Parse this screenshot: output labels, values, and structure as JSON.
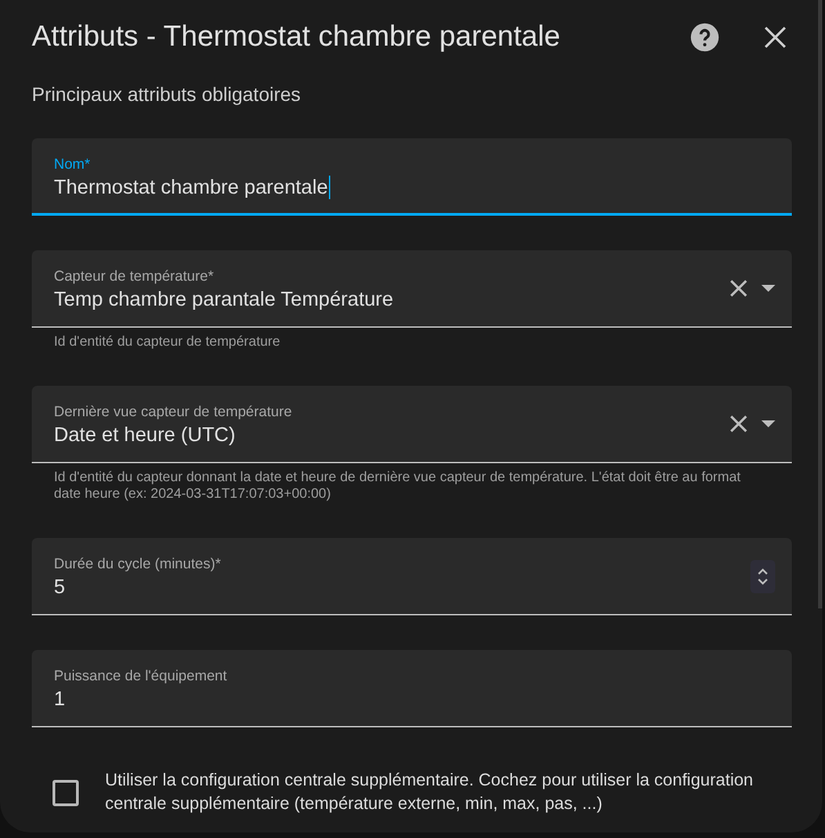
{
  "dialog": {
    "title": "Attributs - Thermostat chambre parentale",
    "subtitle": "Principaux attributs obligatoires"
  },
  "fields": [
    {
      "kind": "text",
      "label": "Nom*",
      "value": "Thermostat chambre parentale",
      "focused": true
    },
    {
      "kind": "select",
      "label": "Capteur de température*",
      "value": "Temp chambre parantale Température",
      "focused": false,
      "helper": "Id d'entité du capteur de température"
    },
    {
      "kind": "select",
      "label": "Dernière vue capteur de température",
      "value": "Date et heure (UTC)",
      "focused": false,
      "helper": "Id d'entité du capteur donnant la date et heure de dernière vue capteur de température. L'état doit être au format date heure (ex: 2024-03-31T17:07:03+00:00)"
    },
    {
      "kind": "number",
      "label": "Durée du cycle (minutes)*",
      "value": "5",
      "focused": false
    },
    {
      "kind": "text",
      "label": "Puissance de l'équipement",
      "value": "1",
      "focused": false
    }
  ],
  "checkbox": {
    "label": "Utiliser la configuration centrale supplémentaire. Cochez pour utiliser la configuration centrale supplémentaire (température externe, min, max, pas, ...)",
    "checked": false
  }
}
